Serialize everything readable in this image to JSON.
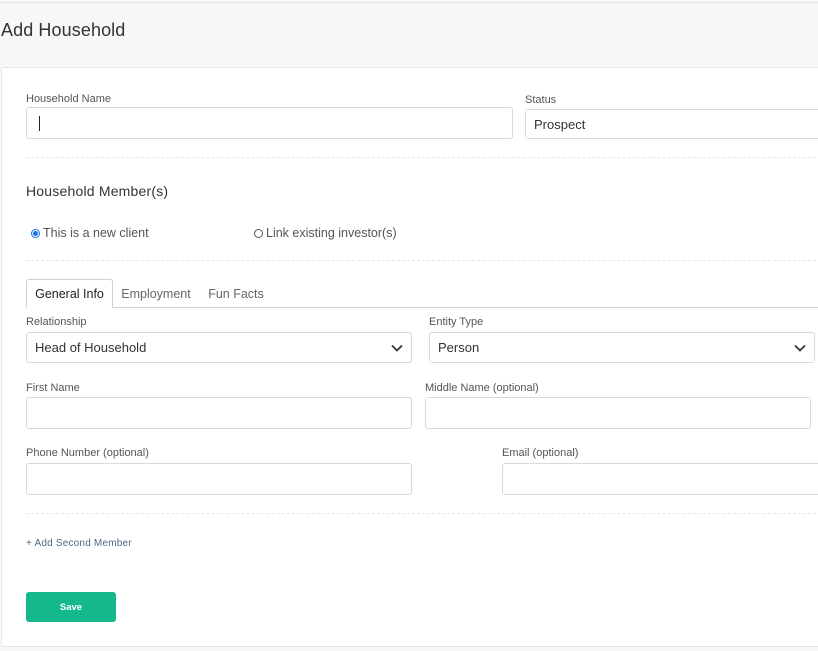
{
  "page": {
    "title": "Add Household"
  },
  "household": {
    "name_label": "Household Name",
    "name_value": "",
    "status_label": "Status",
    "status_value": "Prospect"
  },
  "members": {
    "section_title": "Household Member(s)",
    "client_options": [
      {
        "label": "This is a new client",
        "checked": true
      },
      {
        "label": "Link existing investor(s)",
        "checked": false
      }
    ],
    "tabs": [
      {
        "label": "General Info",
        "active": true
      },
      {
        "label": "Employment",
        "active": false
      },
      {
        "label": "Fun Facts",
        "active": false
      }
    ],
    "fields": {
      "relationship_label": "Relationship",
      "relationship_value": "Head of Household",
      "entity_type_label": "Entity Type",
      "entity_type_value": "Person",
      "first_name_label": "First Name",
      "middle_name_label": "Middle Name (optional)",
      "phone_label": "Phone Number (optional)",
      "email_label": "Email (optional)"
    },
    "add_second_member": "+ Add Second Member"
  },
  "actions": {
    "save_label": "Save"
  },
  "colors": {
    "accent": "#15b88b",
    "radio_selected": "#1a73e8",
    "link": "#4a6a86"
  },
  "icons": {
    "select_caret": "chevron-down-icon",
    "radio_checked": "radio-checked-icon",
    "radio_unchecked": "radio-unchecked-icon"
  }
}
